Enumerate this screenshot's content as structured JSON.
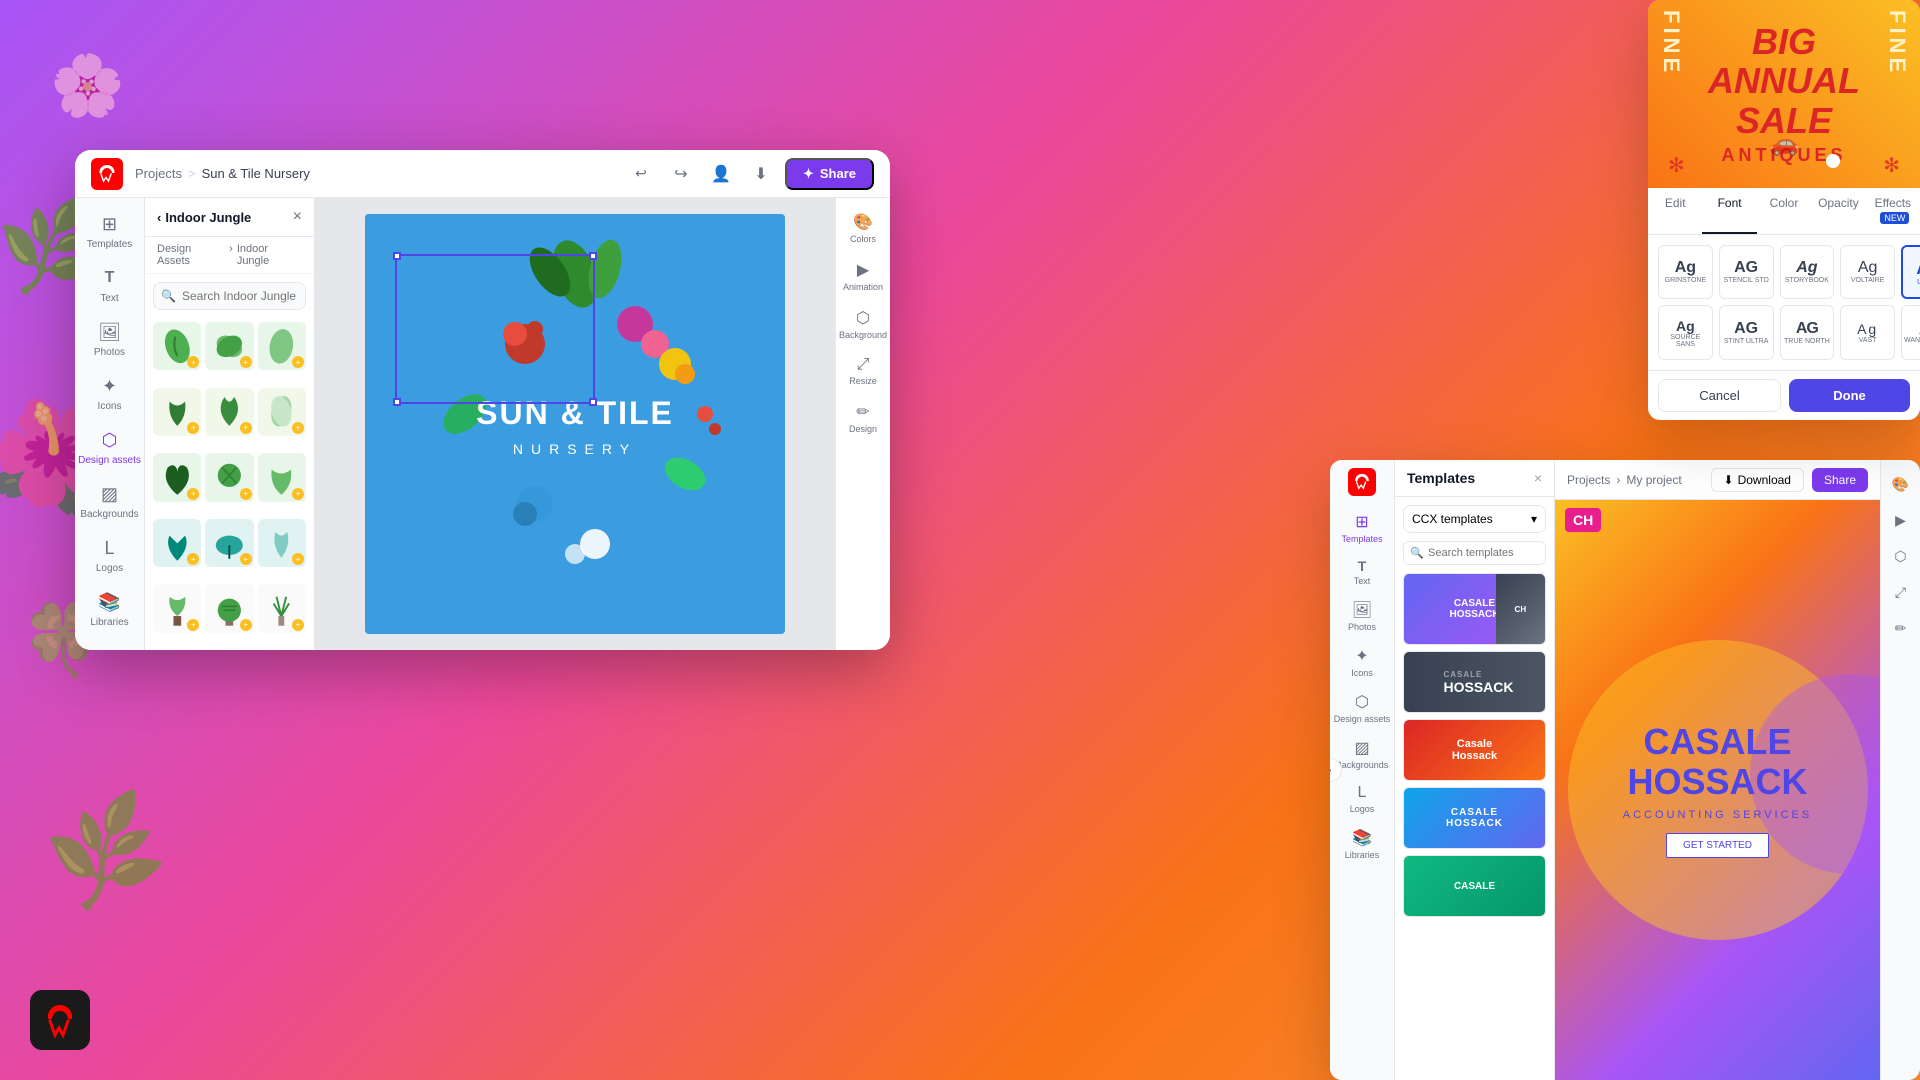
{
  "app": {
    "name": "Adobe Express"
  },
  "editor": {
    "breadcrumb": {
      "projects": "Projects",
      "separator": ">",
      "current": "Sun & Tile Nursery"
    },
    "header": {
      "share_label": "Share",
      "download_tooltip": "Download"
    },
    "panel": {
      "title": "Indoor Jungle",
      "back_arrow": "‹",
      "close": "×",
      "breadcrumb_root": "Design Assets",
      "breadcrumb_sub": "Indoor Jungle",
      "search_placeholder": "Search Indoor Jungle"
    },
    "sidebar_items": [
      {
        "id": "templates",
        "label": "Templates",
        "icon": "⊞"
      },
      {
        "id": "text",
        "label": "Text",
        "icon": "T"
      },
      {
        "id": "photos",
        "label": "Photos",
        "icon": "🖼"
      },
      {
        "id": "icons",
        "label": "Icons",
        "icon": "✦"
      },
      {
        "id": "design-assets",
        "label": "Design assets",
        "icon": "⬡",
        "active": true
      },
      {
        "id": "backgrounds",
        "label": "Backgrounds",
        "icon": "▨"
      },
      {
        "id": "logos",
        "label": "Logos",
        "icon": "L"
      },
      {
        "id": "libraries",
        "label": "Libraries",
        "icon": "📚"
      }
    ],
    "right_tools": [
      {
        "id": "colors",
        "label": "Colors",
        "icon": "🎨"
      },
      {
        "id": "animation",
        "label": "Animation",
        "icon": "▶"
      },
      {
        "id": "background",
        "label": "Background",
        "icon": "⬡"
      },
      {
        "id": "resize",
        "label": "Resize",
        "icon": "⤢"
      },
      {
        "id": "design",
        "label": "Design",
        "icon": "✏"
      }
    ],
    "canvas": {
      "main_text": "SUN & TILE",
      "sub_text": "NURSERY"
    }
  },
  "font_panel": {
    "preview": {
      "big_text": "BIG",
      "annual_text": "ANNUAL",
      "sale_text": "SALE",
      "fine_text": "FINE",
      "antiques_text": "ANTIQUES"
    },
    "tabs": [
      {
        "id": "edit",
        "label": "Edit",
        "active": false
      },
      {
        "id": "font",
        "label": "Font",
        "active": true
      },
      {
        "id": "color",
        "label": "Color",
        "active": false
      },
      {
        "id": "opacity",
        "label": "Opacity",
        "active": false
      },
      {
        "id": "effects",
        "label": "Effects",
        "active": false,
        "badge": "NEW"
      }
    ],
    "fonts": [
      {
        "id": "grinstone",
        "name": "GRINSTONE",
        "sample": "Ag",
        "selected": false
      },
      {
        "id": "stencil-std",
        "name": "STENCIL STD",
        "sample": "AG",
        "selected": false
      },
      {
        "id": "storybook",
        "name": "STORYBOOK",
        "sample": "Ag",
        "selected": false
      },
      {
        "id": "voltaire",
        "name": "VOLTAIRE",
        "sample": "Ag",
        "selected": false
      },
      {
        "id": "ultra",
        "name": "ULTRA",
        "sample": "Ag",
        "selected": true
      },
      {
        "id": "source-sans",
        "name": "SOURCE SANS",
        "sample": "Ag",
        "selected": false
      },
      {
        "id": "stint-ultra",
        "name": "STINT ULTRA",
        "sample": "AG",
        "selected": false
      },
      {
        "id": "true-north",
        "name": "TRUE NORTH",
        "sample": "AG",
        "selected": false
      },
      {
        "id": "vast",
        "name": "VAST",
        "sample": "Ag",
        "selected": false
      },
      {
        "id": "wanderlust",
        "name": "WANDERLUST",
        "sample": "Ag",
        "selected": false
      }
    ],
    "cancel_label": "Cancel",
    "done_label": "Done"
  },
  "templates_panel": {
    "title": "Templates",
    "dropdown_value": "CCX templates",
    "search_placeholder": "Search templates",
    "close": "×",
    "header": {
      "breadcrumb_root": "Projects",
      "breadcrumb_sub": "My project",
      "download_label": "Download",
      "share_label": "Share"
    },
    "canvas_preview": {
      "brand_initial": "CH",
      "main_text": "CASALE\nHOSSACK",
      "sub_text": "ACCOUNTING SERVICES",
      "cta_label": "GET STARTED"
    },
    "sidebar_items": [
      {
        "id": "templates",
        "label": "Templates",
        "icon": "⊞",
        "active": true
      },
      {
        "id": "text",
        "label": "Text",
        "icon": "T"
      },
      {
        "id": "photos",
        "label": "Photos",
        "icon": "🖼"
      },
      {
        "id": "icons",
        "label": "Icons",
        "icon": "✦"
      },
      {
        "id": "design-assets",
        "label": "Design assets",
        "icon": "⬡"
      },
      {
        "id": "backgrounds",
        "label": "Backgrounds",
        "icon": "▨"
      },
      {
        "id": "logos",
        "label": "Logos",
        "icon": "L"
      },
      {
        "id": "libraries",
        "label": "Libraries",
        "icon": "📚"
      }
    ],
    "thumbnails": [
      {
        "id": "t1",
        "class": "tmpl-t1",
        "label": "CASALE HOSSACK"
      },
      {
        "id": "t2",
        "class": "tmpl-t2",
        "label": "CASALE HOSSACK"
      },
      {
        "id": "t3",
        "class": "tmpl-t3",
        "label": "Casale Hossack"
      },
      {
        "id": "t4",
        "class": "tmpl-t4",
        "label": "CASALE HOSSACK"
      },
      {
        "id": "t5",
        "class": "tmpl-t5",
        "label": "CASALE HOSSACK"
      }
    ]
  }
}
